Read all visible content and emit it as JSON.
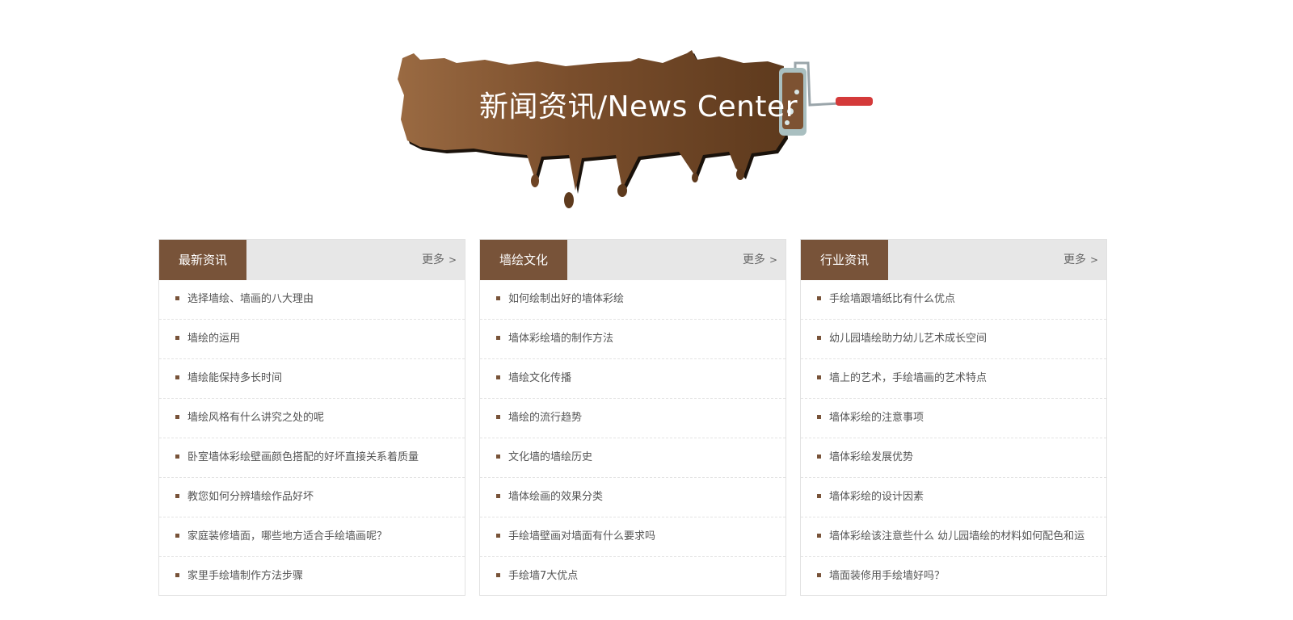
{
  "banner": {
    "title": "新闻资讯/News Center",
    "paint_color": "#6b4426",
    "roller_handle_color": "#d43a3a"
  },
  "columns": [
    {
      "tab": "最新资讯",
      "more": "更多",
      "more_arrow": ">",
      "items": [
        "选择墙绘、墙画的八大理由",
        "墙绘的运用",
        "墙绘能保持多长时间",
        "墙绘风格有什么讲究之处的呢",
        "卧室墙体彩绘壁画颜色搭配的好坏直接关系着质量",
        "教您如何分辨墙绘作品好坏",
        "家庭装修墙面，哪些地方适合手绘墙画呢？",
        "家里手绘墙制作方法步骤"
      ]
    },
    {
      "tab": "墙绘文化",
      "more": "更多",
      "more_arrow": ">",
      "items": [
        "如何绘制出好的墙体彩绘",
        "墙体彩绘墙的制作方法",
        "墙绘文化传播",
        "墙绘的流行趋势",
        "文化墙的墙绘历史",
        "墙体绘画的效果分类",
        "手绘墙壁画对墙面有什么要求吗",
        "手绘墙7大优点"
      ]
    },
    {
      "tab": "行业资讯",
      "more": "更多",
      "more_arrow": ">",
      "items": [
        "手绘墙跟墙纸比有什么优点",
        "幼儿园墙绘助力幼儿艺术成长空间",
        "墙上的艺术，手绘墙画的艺术特点",
        "墙体彩绘的注意事项",
        "墙体彩绘发展优势",
        "墙体彩绘的设计因素",
        "墙体彩绘该注意些什么 幼儿园墙绘的材料如何配色和运",
        "墙面装修用手绘墙好吗？"
      ]
    }
  ],
  "colors": {
    "accent": "#785339",
    "header_bg": "#e7e7e7",
    "border": "#e2e2e2"
  }
}
